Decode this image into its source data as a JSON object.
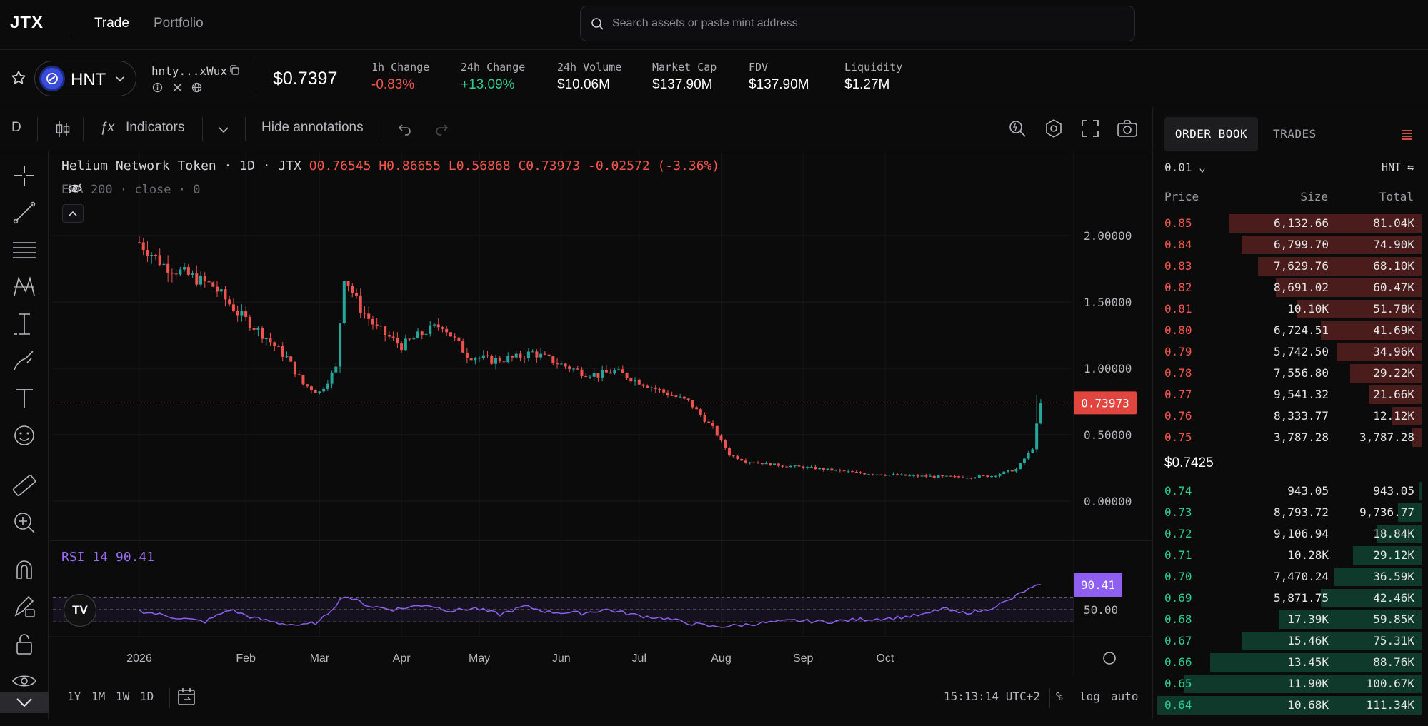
{
  "app": {
    "logo": "JTX"
  },
  "nav": {
    "trade": "Trade",
    "portfolio": "Portfolio"
  },
  "search": {
    "placeholder": "Search assets or paste mint address"
  },
  "token": {
    "symbol": "HNT",
    "mint_short": "hnty...xWux",
    "price": "$0.7397",
    "logo_color": "#3a4bd8"
  },
  "stats": [
    {
      "label": "1h Change",
      "value": "-0.83%",
      "tone": "neg"
    },
    {
      "label": "24h Change",
      "value": "+13.09%",
      "tone": "pos"
    },
    {
      "label": "24h Volume",
      "value": "$10.06M",
      "tone": ""
    },
    {
      "label": "Market Cap",
      "value": "$137.90M",
      "tone": ""
    },
    {
      "label": "FDV",
      "value": "$137.90M",
      "tone": ""
    },
    {
      "label": "Liquidity",
      "value": "$1.27M",
      "tone": ""
    }
  ],
  "toolbar": {
    "interval": "D",
    "indicators": "Indicators",
    "hide_annotations": "Hide annotations"
  },
  "chart_legend": {
    "name": "Helium Network Token · 1D · JTX",
    "o": "O0.76545",
    "h": "H0.86655",
    "l": "L0.56868",
    "c": "C0.73973",
    "chg": "-0.02572 (-3.36%)",
    "ema": "EMA 200 · close · 0"
  },
  "rsi": {
    "label": "RSI 14",
    "value": "90.41",
    "tag": "90.41",
    "level_label": "50.00"
  },
  "chart_data": {
    "type": "candlestick",
    "x_ticks": [
      "2026",
      "Feb",
      "Mar",
      "Apr",
      "May",
      "Jun",
      "Jul",
      "Aug",
      "Sep",
      "Oct"
    ],
    "y_ticks": [
      "2.00000",
      "1.50000",
      "1.00000",
      "0.50000",
      "0.00000"
    ],
    "ylim": [
      0,
      2
    ],
    "last_price_tag": "0.73973",
    "last_price": 0.73973,
    "close_path": [
      [
        0,
        1.95
      ],
      [
        6,
        1.78
      ],
      [
        12,
        1.7
      ],
      [
        18,
        1.62
      ],
      [
        24,
        1.42
      ],
      [
        30,
        1.26
      ],
      [
        36,
        1.08
      ],
      [
        40,
        0.88
      ],
      [
        44,
        0.82
      ],
      [
        48,
        1.0
      ],
      [
        50,
        1.7
      ],
      [
        54,
        1.45
      ],
      [
        58,
        1.3
      ],
      [
        64,
        1.17
      ],
      [
        70,
        1.28
      ],
      [
        74,
        1.33
      ],
      [
        80,
        1.1
      ],
      [
        86,
        1.06
      ],
      [
        92,
        1.08
      ],
      [
        96,
        1.12
      ],
      [
        102,
        1.04
      ],
      [
        108,
        0.97
      ],
      [
        112,
        0.95
      ],
      [
        116,
        0.98
      ],
      [
        122,
        0.9
      ],
      [
        128,
        0.82
      ],
      [
        134,
        0.75
      ],
      [
        140,
        0.55
      ],
      [
        144,
        0.35
      ],
      [
        148,
        0.3
      ],
      [
        156,
        0.27
      ],
      [
        164,
        0.25
      ],
      [
        176,
        0.21
      ],
      [
        188,
        0.19
      ],
      [
        200,
        0.18
      ],
      [
        208,
        0.19
      ],
      [
        214,
        0.24
      ],
      [
        218,
        0.4
      ],
      [
        220,
        0.74
      ]
    ],
    "x_domain": [
      0,
      265
    ],
    "rsi_path": [
      [
        0,
        48
      ],
      [
        8,
        38
      ],
      [
        16,
        30
      ],
      [
        22,
        50
      ],
      [
        28,
        36
      ],
      [
        34,
        28
      ],
      [
        40,
        24
      ],
      [
        44,
        30
      ],
      [
        48,
        58
      ],
      [
        50,
        73
      ],
      [
        56,
        56
      ],
      [
        62,
        50
      ],
      [
        70,
        58
      ],
      [
        76,
        48
      ],
      [
        82,
        52
      ],
      [
        88,
        42
      ],
      [
        94,
        55
      ],
      [
        100,
        46
      ],
      [
        108,
        44
      ],
      [
        114,
        50
      ],
      [
        122,
        40
      ],
      [
        128,
        36
      ],
      [
        134,
        28
      ],
      [
        140,
        22
      ],
      [
        146,
        24
      ],
      [
        152,
        28
      ],
      [
        160,
        32
      ],
      [
        168,
        30
      ],
      [
        176,
        34
      ],
      [
        184,
        36
      ],
      [
        192,
        42
      ],
      [
        196,
        52
      ],
      [
        200,
        44
      ],
      [
        206,
        48
      ],
      [
        212,
        64
      ],
      [
        216,
        80
      ],
      [
        220,
        90.41
      ]
    ],
    "rsi_ylim": [
      0,
      100
    ]
  },
  "bottom_bar": {
    "timeframes": [
      "1Y",
      "1M",
      "1W",
      "1D"
    ],
    "clock": "15:13:14 UTC+2",
    "pct": "%",
    "log": "log",
    "auto": "auto"
  },
  "orderbook": {
    "tab_orderbook": "ORDER BOOK",
    "tab_trades": "TRADES",
    "tick": "0.01",
    "unit": "HNT",
    "head_price": "Price",
    "head_size": "Size",
    "head_total": "Total",
    "mid_price": "$0.7425",
    "asks": [
      {
        "price": "0.85",
        "size": "6,132.66",
        "total": "81.04K",
        "depth": 0.73
      },
      {
        "price": "0.84",
        "size": "6,799.70",
        "total": "74.90K",
        "depth": 0.68
      },
      {
        "price": "0.83",
        "size": "7,629.76",
        "total": "68.10K",
        "depth": 0.62
      },
      {
        "price": "0.82",
        "size": "8,691.02",
        "total": "60.47K",
        "depth": 0.55
      },
      {
        "price": "0.81",
        "size": "10.10K",
        "total": "51.78K",
        "depth": 0.47
      },
      {
        "price": "0.80",
        "size": "6,724.51",
        "total": "41.69K",
        "depth": 0.38
      },
      {
        "price": "0.79",
        "size": "5,742.50",
        "total": "34.96K",
        "depth": 0.32
      },
      {
        "price": "0.78",
        "size": "7,556.80",
        "total": "29.22K",
        "depth": 0.27
      },
      {
        "price": "0.77",
        "size": "9,541.32",
        "total": "21.66K",
        "depth": 0.2
      },
      {
        "price": "0.76",
        "size": "8,333.77",
        "total": "12.12K",
        "depth": 0.11
      },
      {
        "price": "0.75",
        "size": "3,787.28",
        "total": "3,787.28",
        "depth": 0.035
      }
    ],
    "bids": [
      {
        "price": "0.74",
        "size": "943.05",
        "total": "943.05",
        "depth": 0.01
      },
      {
        "price": "0.73",
        "size": "8,793.72",
        "total": "9,736.77",
        "depth": 0.09
      },
      {
        "price": "0.72",
        "size": "9,106.94",
        "total": "18.84K",
        "depth": 0.17
      },
      {
        "price": "0.71",
        "size": "10.28K",
        "total": "29.12K",
        "depth": 0.26
      },
      {
        "price": "0.70",
        "size": "7,470.24",
        "total": "36.59K",
        "depth": 0.33
      },
      {
        "price": "0.69",
        "size": "5,871.75",
        "total": "42.46K",
        "depth": 0.38
      },
      {
        "price": "0.68",
        "size": "17.39K",
        "total": "59.85K",
        "depth": 0.54
      },
      {
        "price": "0.67",
        "size": "15.46K",
        "total": "75.31K",
        "depth": 0.68
      },
      {
        "price": "0.66",
        "size": "13.45K",
        "total": "88.76K",
        "depth": 0.8
      },
      {
        "price": "0.65",
        "size": "11.90K",
        "total": "100.67K",
        "depth": 0.9
      },
      {
        "price": "0.64",
        "size": "10.68K",
        "total": "111.34K",
        "depth": 1.0
      }
    ]
  },
  "colors": {
    "up": "#26a69a",
    "down": "#ef5350",
    "ask_text": "#f2564d",
    "bid_text": "#2ecc8f",
    "ask_bar": "#4a1d1c",
    "bid_bar": "#0f3a2b",
    "rsi": "#8e5ff0",
    "tag": "#e0453e"
  }
}
